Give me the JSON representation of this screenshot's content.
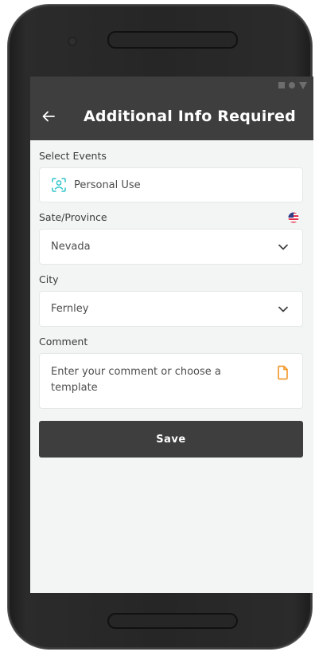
{
  "app_bar": {
    "title": "Additional Info Required",
    "back_icon": "arrow-left-icon"
  },
  "status_bar": {
    "icons": [
      "signal-icon",
      "wifi-icon",
      "battery-icon"
    ]
  },
  "form": {
    "events": {
      "label": "Select Events",
      "value": "Personal Use",
      "icon": "person-scan-icon"
    },
    "state": {
      "label": "Sate/Province",
      "value": "Nevada",
      "flag_icon": "us-flag-icon"
    },
    "city": {
      "label": "City",
      "value": "Fernley"
    },
    "comment": {
      "label": "Comment",
      "placeholder": "Enter your comment or choose a template",
      "icon": "template-document-icon"
    },
    "save_label": "Save"
  },
  "colors": {
    "header_bg": "#3e3e3e",
    "content_bg": "#f3f5f5",
    "accent_teal": "#2ec4c8",
    "accent_orange": "#f39c34",
    "flag_red": "#e0314b",
    "flag_blue": "#2f3e88"
  }
}
